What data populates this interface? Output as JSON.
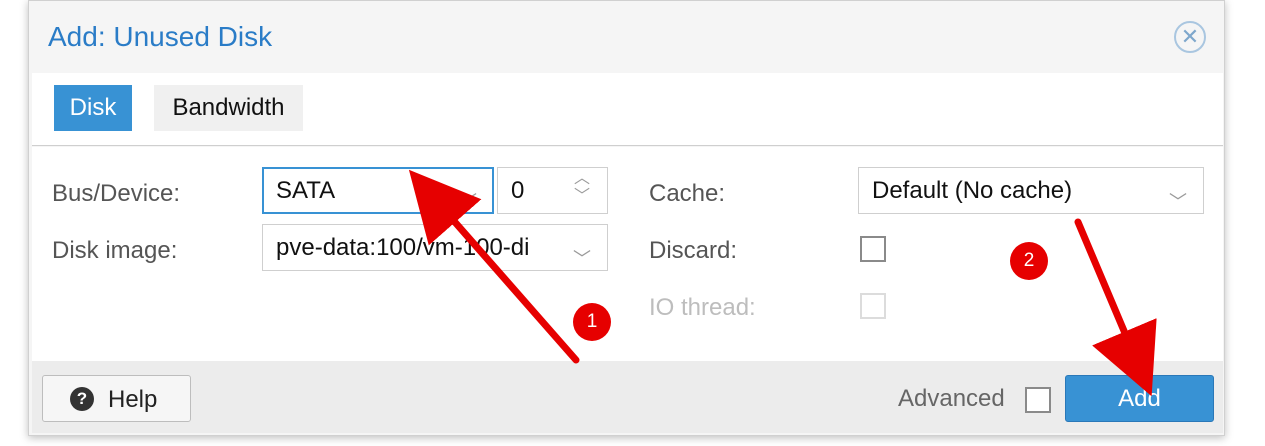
{
  "dialog": {
    "title": "Add: Unused Disk",
    "close_icon": "close-circle-icon"
  },
  "tabs": [
    {
      "label": "Disk",
      "active": true
    },
    {
      "label": "Bandwidth",
      "active": false
    }
  ],
  "form": {
    "bus_device": {
      "label": "Bus/Device:",
      "bus_value": "SATA",
      "device_value": "0"
    },
    "disk_image": {
      "label": "Disk image:",
      "value": "pve-data:100/vm-100-di"
    },
    "cache": {
      "label": "Cache:",
      "value": "Default (No cache)"
    },
    "discard": {
      "label": "Discard:",
      "checked": false
    },
    "io_thread": {
      "label": "IO thread:",
      "checked": false,
      "disabled": true
    }
  },
  "footer": {
    "help_label": "Help",
    "help_icon": "question-circle-icon",
    "advanced_label": "Advanced",
    "advanced_checked": false,
    "add_label": "Add"
  },
  "annotations": {
    "badge_1": "1",
    "badge_2": "2",
    "color": "#e60000"
  },
  "colors": {
    "accent": "#3892d4",
    "title": "#2a7cc7"
  }
}
